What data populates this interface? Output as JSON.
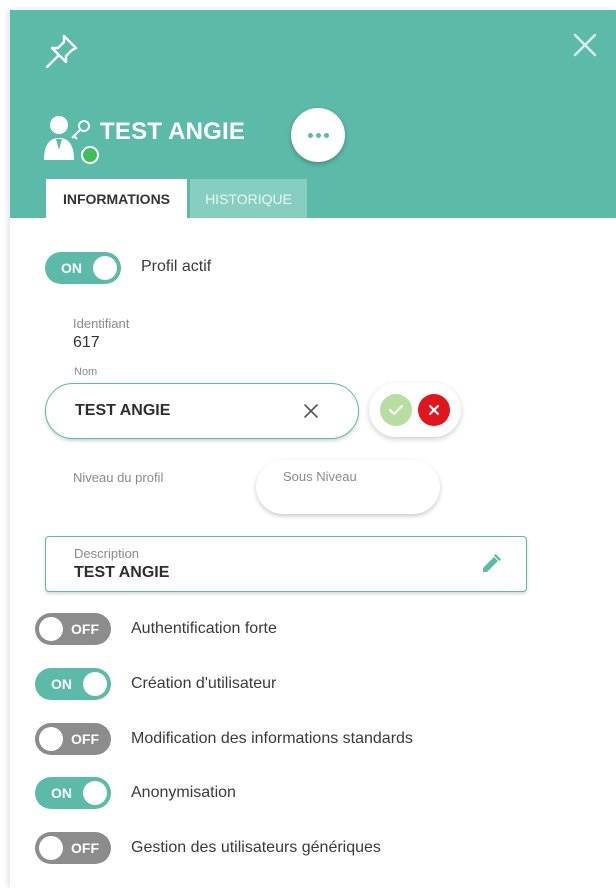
{
  "header": {
    "title": "TEST ANGIE",
    "accent_color": "#5cbaa8",
    "status_color": "#3fbf5a",
    "icons": [
      "pin-icon",
      "close-icon",
      "user-key-icon",
      "more-options-icon"
    ]
  },
  "tabs": [
    {
      "label": "INFORMATIONS",
      "active": true
    },
    {
      "label": "HISTORIQUE",
      "active": false
    }
  ],
  "profile_active": {
    "state": "ON",
    "label": "Profil actif",
    "on": true
  },
  "identifiant": {
    "label": "Identifiant",
    "value": "617"
  },
  "nom": {
    "label": "Nom",
    "value": "TEST ANGIE"
  },
  "niveau": {
    "label": "Niveau du profil"
  },
  "sous_niveau": {
    "placeholder": "Sous Niveau"
  },
  "description": {
    "label": "Description",
    "value": "TEST ANGIE"
  },
  "permissions": [
    {
      "label": "Authentification forte",
      "state": "OFF",
      "on": false
    },
    {
      "label": "Création d'utilisateur",
      "state": "ON",
      "on": true
    },
    {
      "label": "Modification des informations standards",
      "state": "OFF",
      "on": false
    },
    {
      "label": "Anonymisation",
      "state": "ON",
      "on": true
    },
    {
      "label": "Gestion des utilisateurs génériques",
      "state": "OFF",
      "on": false
    }
  ],
  "colors": {
    "toggle_on": "#5cbaa8",
    "toggle_off": "#8c8c8c",
    "confirm": "#b7dda0",
    "cancel": "#e0161c"
  }
}
